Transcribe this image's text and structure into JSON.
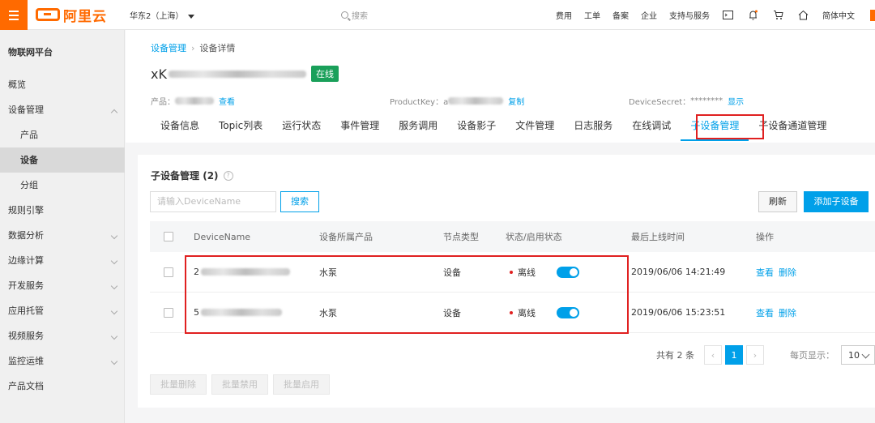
{
  "topbar": {
    "logo_text": "阿里云",
    "region": "华东2（上海）",
    "search_placeholder": "搜索",
    "links": [
      "费用",
      "工单",
      "备案",
      "企业",
      "支持与服务"
    ],
    "language": "简体中文",
    "icons": [
      "terminal-icon",
      "bell-icon",
      "cart-icon",
      "home-icon"
    ],
    "accent": "#ff6a00"
  },
  "sidebar": {
    "title": "物联网平台",
    "items": [
      {
        "label": "概览"
      },
      {
        "label": "设备管理"
      },
      {
        "label": "产品"
      },
      {
        "label": "设备"
      },
      {
        "label": "分组"
      },
      {
        "label": "规则引擎"
      },
      {
        "label": "数据分析"
      },
      {
        "label": "边缘计算"
      },
      {
        "label": "开发服务"
      },
      {
        "label": "应用托管"
      },
      {
        "label": "视频服务"
      },
      {
        "label": "监控运维"
      },
      {
        "label": "产品文档"
      }
    ]
  },
  "header": {
    "breadcrumb": [
      "设备管理",
      "设备详情"
    ],
    "device_prefix": "xK",
    "online_badge": "在线",
    "product_label": "产品：",
    "product_link": "查看",
    "productkey_label": "ProductKey：a",
    "productkey_copy": "复制",
    "devicesecret_label": "DeviceSecret：",
    "devicesecret_value": "********",
    "devicesecret_show": "显示"
  },
  "tabs": [
    "设备信息",
    "Topic列表",
    "运行状态",
    "事件管理",
    "服务调用",
    "设备影子",
    "文件管理",
    "日志服务",
    "在线调试",
    "子设备管理",
    "子设备通道管理"
  ],
  "subdevices": {
    "title": "子设备管理",
    "count": "(2)",
    "search_placeholder": "请输入DeviceName",
    "search_button": "搜索",
    "refresh_button": "刷新",
    "add_button": "添加子设备",
    "columns": [
      "DeviceName",
      "设备所属产品",
      "节点类型",
      "状态/启用状态",
      "最后上线时间",
      "操作"
    ],
    "rows": [
      {
        "name_prefix": "2",
        "product": "水泵",
        "node_type": "设备",
        "status": "离线",
        "enabled": true,
        "last_online": "2019/06/06 14:21:49",
        "view": "查看",
        "delete": "删除"
      },
      {
        "name_prefix": "5",
        "product": "水泵",
        "node_type": "设备",
        "status": "离线",
        "enabled": true,
        "last_online": "2019/06/06 15:23:51",
        "view": "查看",
        "delete": "删除"
      }
    ],
    "pager": {
      "total": "共有 2 条",
      "current_page": "1",
      "page_size_label": "每页显示：",
      "page_size": "10"
    },
    "batch_buttons": [
      "批量删除",
      "批量禁用",
      "批量启用"
    ]
  },
  "colors": {
    "link": "#00a0e9",
    "online": "#1aa05a",
    "offline_dot": "#e02020",
    "highlight_box": "#e02020"
  }
}
